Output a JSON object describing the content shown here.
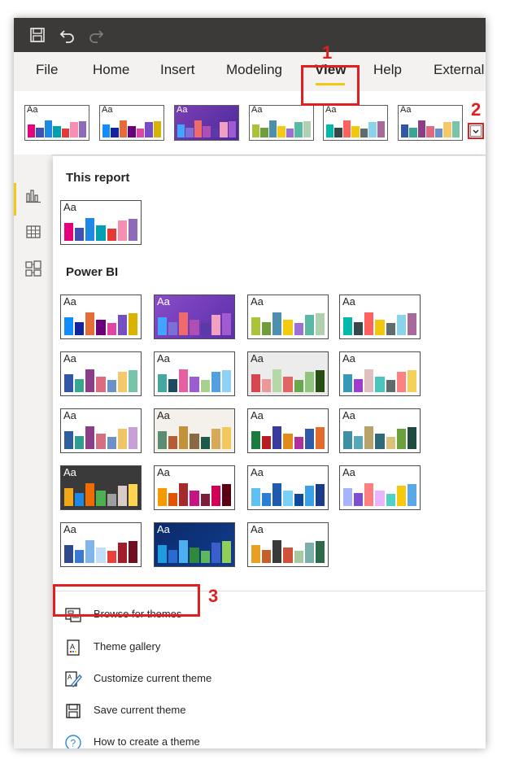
{
  "tabs": {
    "file": "File",
    "home": "Home",
    "insert": "Insert",
    "modeling": "Modeling",
    "view": "View",
    "help": "Help",
    "external": "External"
  },
  "sections": {
    "this_report": "This report",
    "power_bi": "Power BI"
  },
  "thumb_label": "Aa",
  "menu": {
    "browse": "Browse for themes",
    "gallery": "Theme gallery",
    "customize": "Customize current theme",
    "save": "Save current theme",
    "howto": "How to create a theme"
  },
  "callouts": {
    "one": "1",
    "two": "2",
    "three": "3"
  },
  "icons": {
    "save": "save-icon",
    "undo": "undo-icon",
    "redo": "redo-icon",
    "report_view": "bar-chart-icon",
    "data_view": "table-icon",
    "model_view": "model-icon",
    "dropdown": "chevron-down-icon",
    "browse": "browse-icon",
    "gallery": "gallery-icon",
    "customize": "edit-theme-icon",
    "save_theme": "save-icon",
    "help": "help-circle-icon"
  },
  "colors": {
    "accent_yellow": "#f2c811",
    "callout_red": "#e02020"
  }
}
